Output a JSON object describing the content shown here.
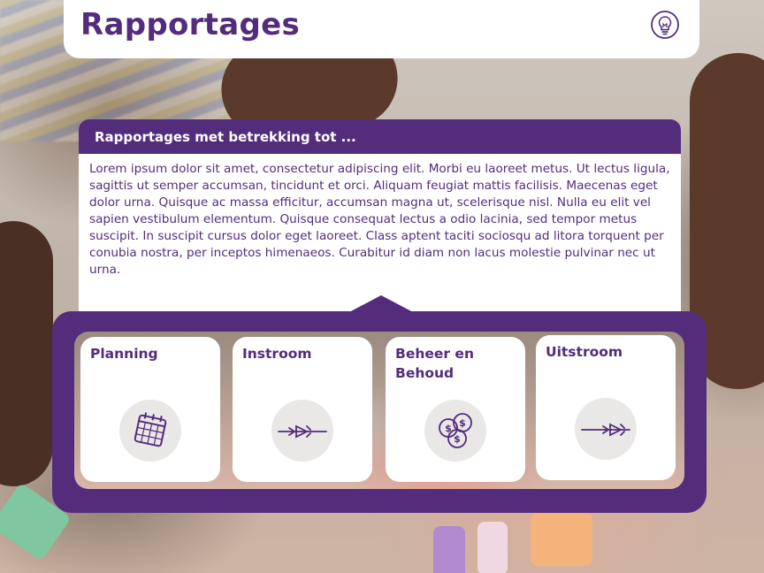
{
  "header": {
    "title": "Rapportages",
    "idea_icon": "lightbulb-icon"
  },
  "panel": {
    "heading": "Rapportages met betrekking tot ...",
    "body": "Lorem ipsum dolor sit amet, consectetur adipiscing elit. Morbi eu laoreet metus. Ut lectus ligula, sagittis ut semper accumsan, tincidunt et orci. Aliquam feugiat mattis facilisis. Maecenas eget dolor urna. Quisque ac massa efficitur, accumsan magna ut, scelerisque nisl. Nulla eu elit vel sapien vestibulum elementum. Quisque consequat lectus a odio lacinia, sed tempor metus suscipit. In suscipit cursus dolor eget laoreet. Class aptent taciti sociosqu ad litora torquent per conubia nostra, per inceptos himenaeos. Curabitur id diam non lacus molestie pulvinar nec ut urna."
  },
  "tiles": [
    {
      "label": "Planning",
      "icon": "calendar-icon"
    },
    {
      "label": "Instroom",
      "icon": "inflow-arrow-icon"
    },
    {
      "label": "Beheer en Behoud",
      "icon": "coins-icon"
    },
    {
      "label": "Uitstroom",
      "icon": "outflow-arrow-icon"
    }
  ],
  "colors": {
    "brand_purple": "#532c7b",
    "tile_bg": "#ffffff",
    "icon_circle": "#e9e8e6"
  }
}
